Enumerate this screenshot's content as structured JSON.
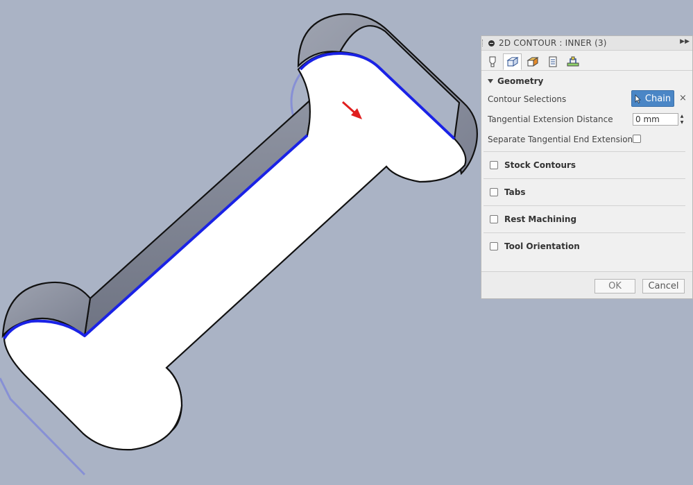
{
  "dialog": {
    "title": "2D CONTOUR : INNER (3)",
    "tabs": [
      "tool-tab",
      "geometry-tab",
      "heights-tab",
      "passes-tab",
      "linking-tab"
    ],
    "geometry": {
      "heading": "Geometry",
      "contour_selections_label": "Contour Selections",
      "chain_button": "Chain",
      "clear_icon": "×",
      "tangential_extension_label": "Tangential Extension Distance",
      "tangential_extension_value": "0 mm",
      "separate_tangential_label": "Separate Tangential End Extension",
      "separate_tangential_checked": false
    },
    "groups": [
      {
        "label": "Stock Contours",
        "checked": false
      },
      {
        "label": "Tabs",
        "checked": false
      },
      {
        "label": "Rest Machining",
        "checked": false
      },
      {
        "label": "Tool Orientation",
        "checked": false
      }
    ],
    "ok_label": "OK",
    "cancel_label": "Cancel"
  },
  "colors": {
    "background": "#aab3c5",
    "selection_chain": "#1a22e6",
    "direction_arrow": "#e01f1f",
    "chain_button": "#4a86c6"
  }
}
